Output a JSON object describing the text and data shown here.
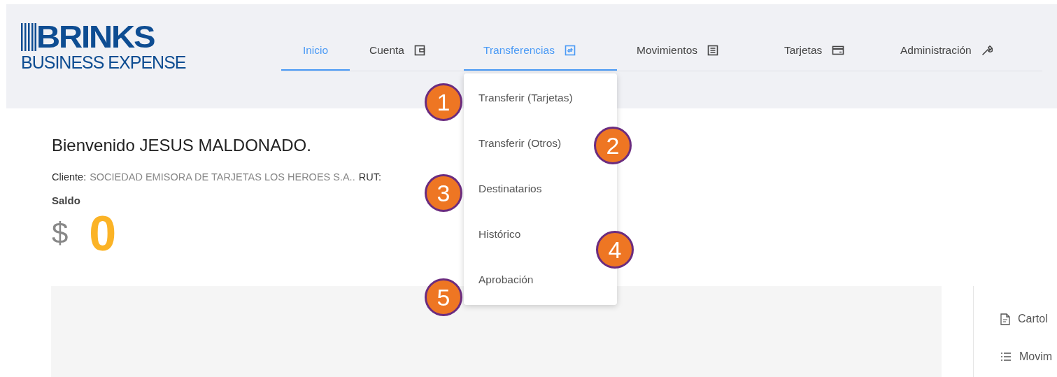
{
  "logo": {
    "name": "BRINKS",
    "tagline": "BUSINESS EXPENSE"
  },
  "nav": [
    {
      "label": "Inicio",
      "selected": true
    },
    {
      "label": "Cuenta",
      "selected": false
    },
    {
      "label": "Transferencias",
      "selected": true
    },
    {
      "label": "Movimientos",
      "selected": false
    },
    {
      "label": "Tarjetas",
      "selected": false
    },
    {
      "label": "Administración",
      "selected": false
    }
  ],
  "dropdown": {
    "open": true,
    "items": [
      "Transferir (Tarjetas)",
      "Transferir (Otros)",
      "Destinatarios",
      "Histórico",
      "Aprobación"
    ]
  },
  "welcome": "Bienvenido JESUS MALDONADO.",
  "client": {
    "label": "Cliente:",
    "value": "SOCIEDAD EMISORA DE TARJETAS LOS HEROES S.A..",
    "rut_label": "RUT:"
  },
  "balance": {
    "label": "Saldo",
    "currency": "$",
    "amount": "0"
  },
  "side_links": [
    "Cartol",
    "Movim"
  ],
  "annotations": [
    "1",
    "2",
    "3",
    "4",
    "5"
  ]
}
